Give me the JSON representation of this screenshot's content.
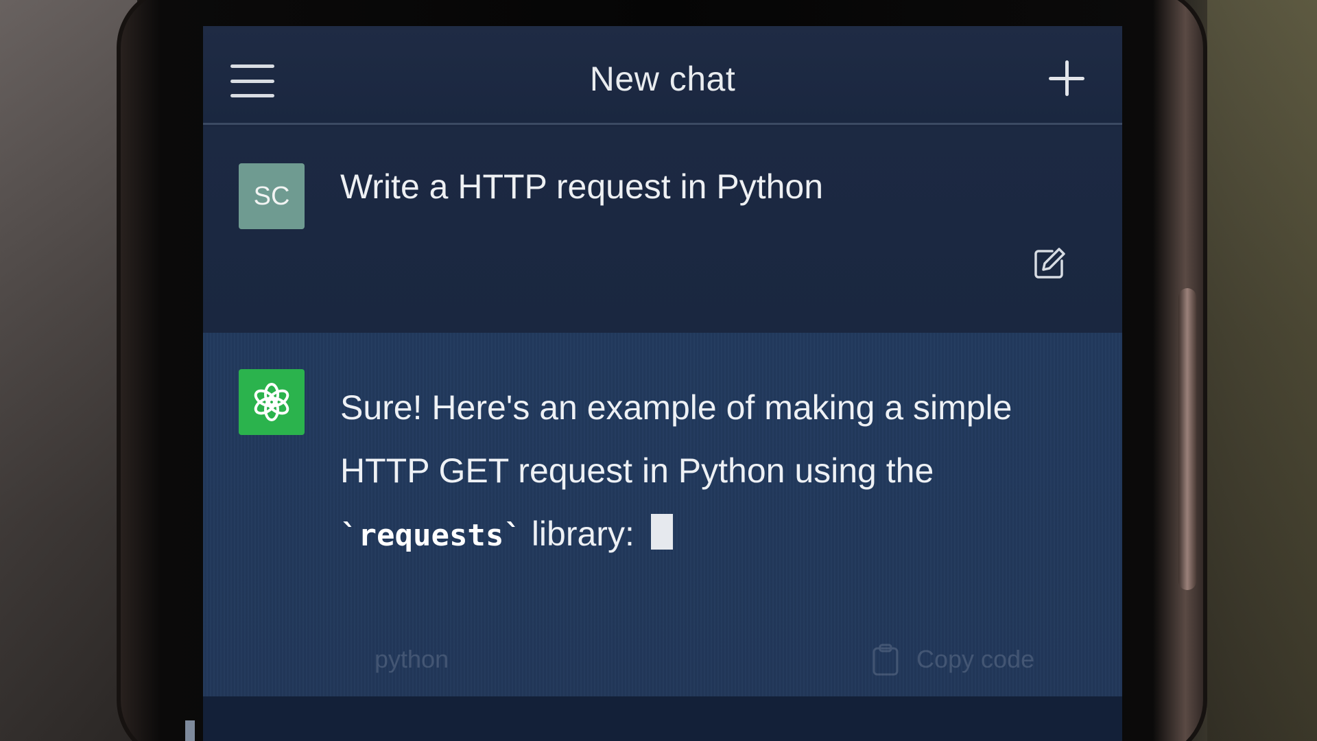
{
  "header": {
    "title": "New chat",
    "menu_icon": "hamburger-menu-icon",
    "new_chat_icon": "plus-icon"
  },
  "user_message": {
    "avatar_initials": "SC",
    "text": "Write a HTTP request in Python",
    "edit_icon": "edit-icon"
  },
  "assistant_message": {
    "avatar_icon": "openai-logo-icon",
    "line1": "Sure! Here's an example of making a simple",
    "line2": "HTTP GET request in Python using the",
    "code_term": "`requests`",
    "line3_suffix": "library:"
  },
  "code_block": {
    "language": "python",
    "copy_label": "Copy code",
    "copy_icon": "clipboard-icon"
  },
  "colors": {
    "screen_bg": "#1b2740",
    "assistant_bg": "#22395c",
    "user_avatar": "#6f9b91",
    "bot_avatar": "#2bb34d"
  }
}
